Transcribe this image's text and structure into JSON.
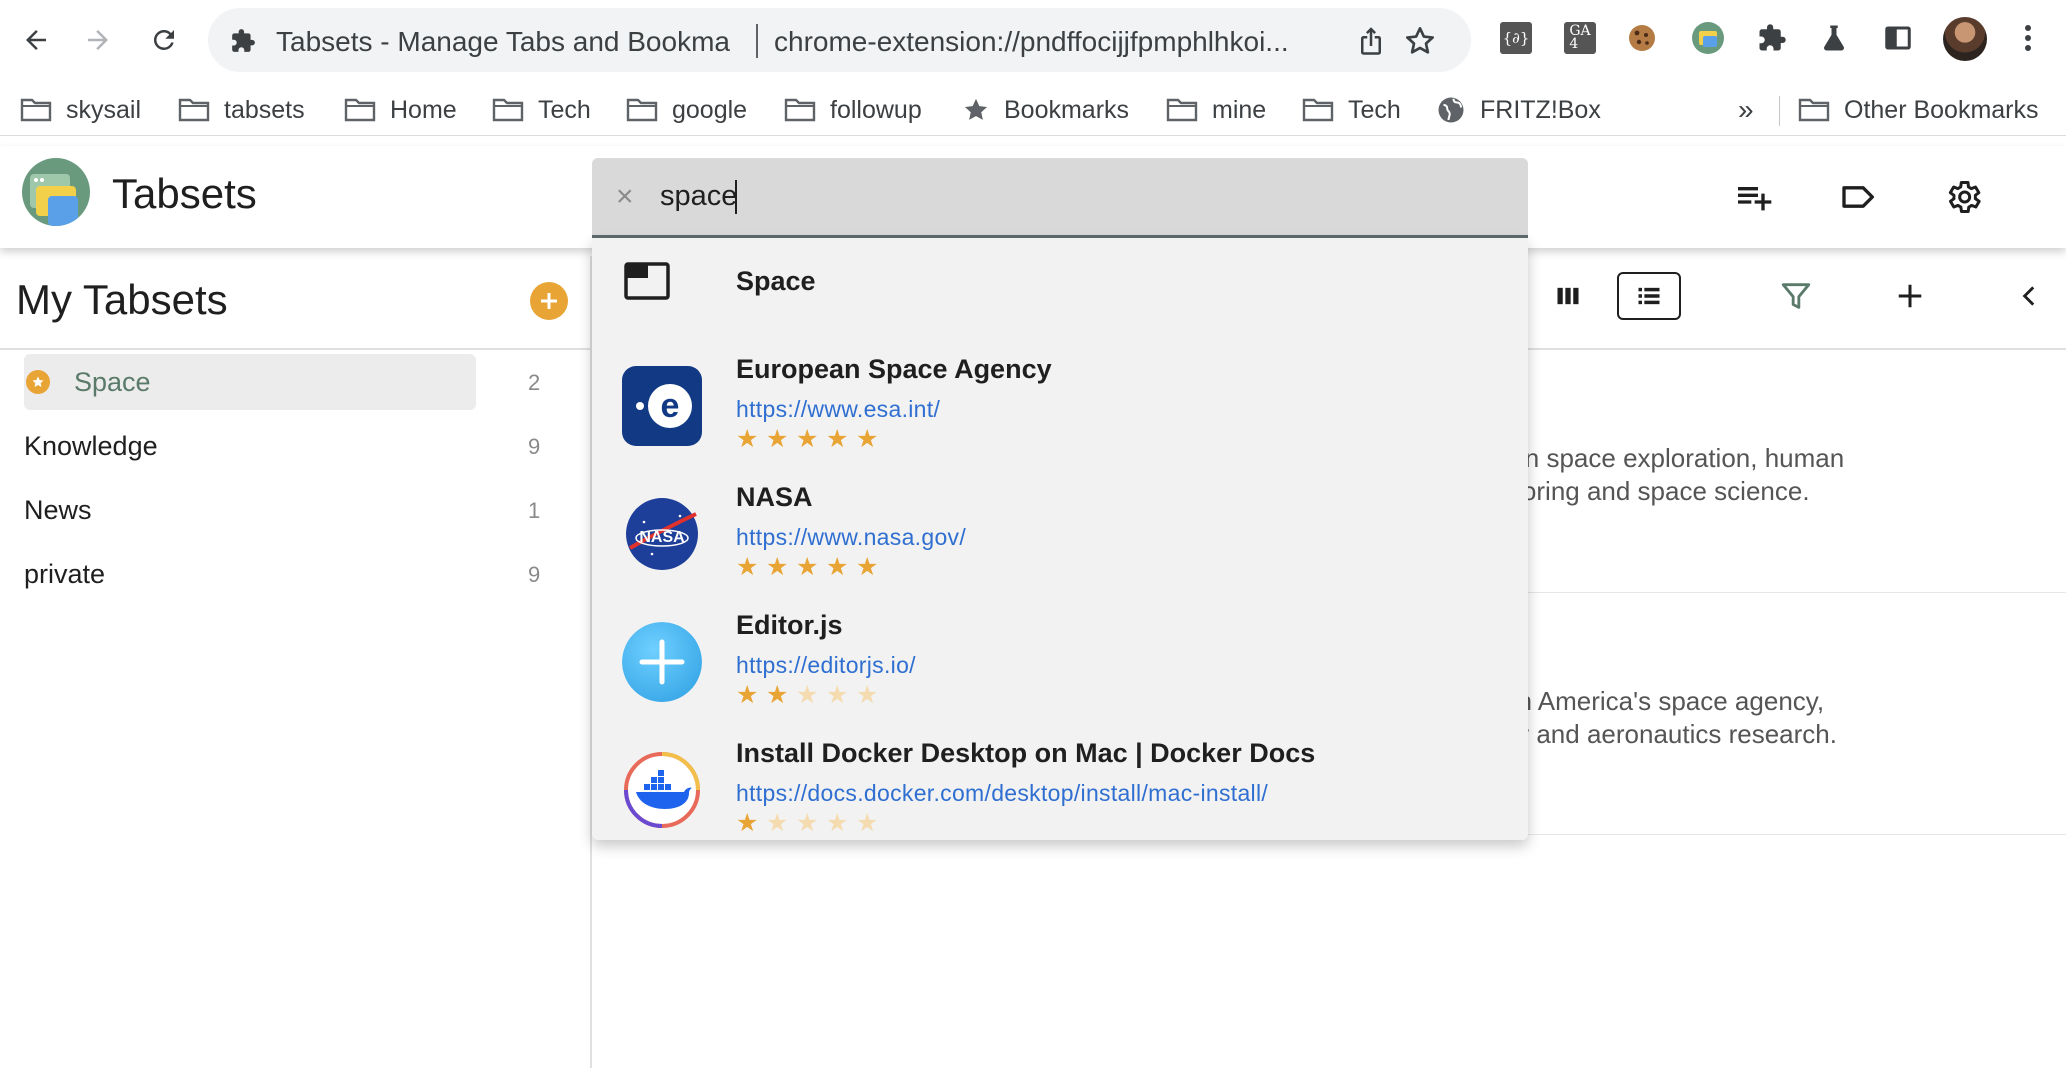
{
  "browser": {
    "tab_title": "Tabsets - Manage Tabs and Bookma",
    "url": "chrome-extension://pndffocijjfpmphlhkoi...",
    "extensions": [
      "json-icon",
      "ga4-icon",
      "cookie-icon",
      "tabsets-icon",
      "puzzle-icon",
      "lab-icon",
      "sidepanel-icon"
    ]
  },
  "bookmarks": [
    {
      "label": "skysail",
      "icon": "folder-icon"
    },
    {
      "label": "tabsets",
      "icon": "folder-icon"
    },
    {
      "label": "Home",
      "icon": "folder-icon"
    },
    {
      "label": "Tech",
      "icon": "folder-icon"
    },
    {
      "label": "google",
      "icon": "folder-icon"
    },
    {
      "label": "followup",
      "icon": "folder-icon"
    },
    {
      "label": "Bookmarks",
      "icon": "star-icon"
    },
    {
      "label": "mine",
      "icon": "folder-icon"
    },
    {
      "label": "Tech",
      "icon": "folder-icon"
    },
    {
      "label": "FRITZ!Box",
      "icon": "globe-icon"
    }
  ],
  "bookmarks_overflow": "»",
  "other_bookmarks": "Other Bookmarks",
  "app": {
    "title": "Tabsets"
  },
  "search": {
    "clear": "×",
    "value": "space"
  },
  "results": [
    {
      "name": "Space",
      "url": "",
      "stars": 0,
      "icon": "tabset-window-icon"
    },
    {
      "name": "European Space Agency",
      "url": "https://www.esa.int/",
      "stars": 5,
      "icon": "esa-logo-icon"
    },
    {
      "name": "NASA",
      "url": "https://www.nasa.gov/",
      "stars": 5,
      "icon": "nasa-logo-icon"
    },
    {
      "name": "Editor.js",
      "url": "https://editorjs.io/",
      "stars": 2,
      "icon": "editorjs-logo-icon"
    },
    {
      "name": "Install Docker Desktop on Mac | Docker Docs",
      "url": "https://docs.docker.com/desktop/install/mac-install/",
      "stars": 1,
      "icon": "docker-logo-icon"
    }
  ],
  "sidebar": {
    "title": "My Tabsets",
    "items": [
      {
        "label": "Space",
        "count": "2",
        "active": true
      },
      {
        "label": "Knowledge",
        "count": "9"
      },
      {
        "label": "News",
        "count": "1"
      },
      {
        "label": "private",
        "count": "9"
      }
    ]
  },
  "cards": [
    {
      "desc_line1": "ws in space exploration, human",
      "desc_line2": "onitoring and space science."
    },
    {
      "desc_line1": "from America's space agency,",
      "desc_line2": "very and aeronautics research."
    }
  ],
  "colors": {
    "accent": "#e8a435",
    "link": "#2f6fd1",
    "active_item_text": "#5a7a6a"
  }
}
